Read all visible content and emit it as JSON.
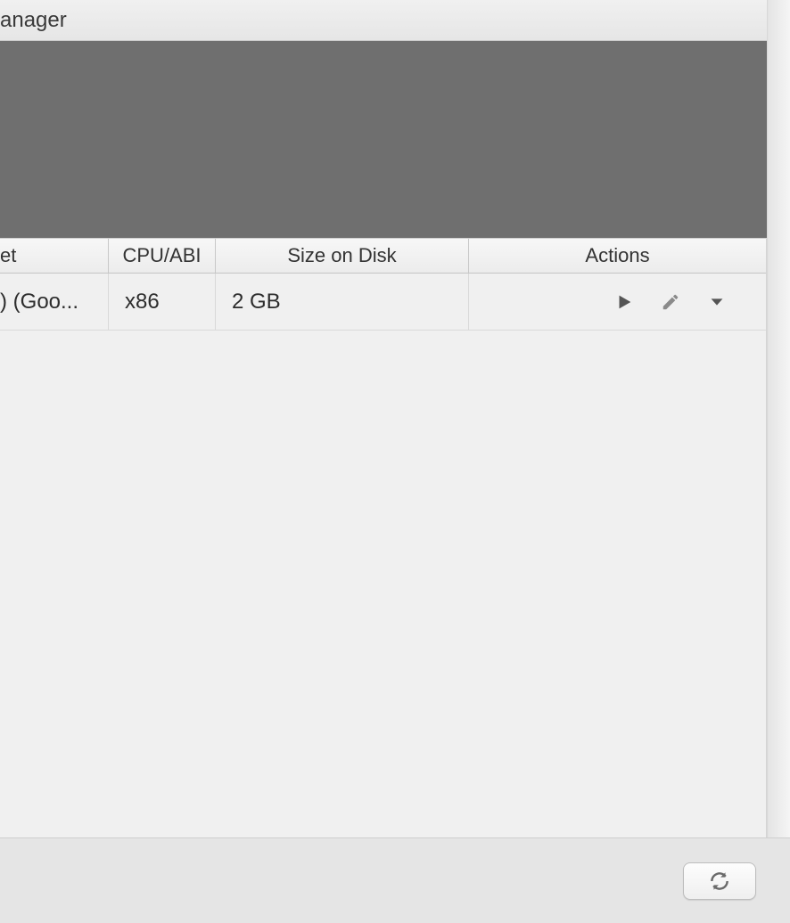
{
  "window": {
    "title_fragment": "anager"
  },
  "table": {
    "headers": {
      "target_fragment": "et",
      "cpu": "CPU/ABI",
      "size": "Size on Disk",
      "actions": "Actions"
    },
    "rows": [
      {
        "target_fragment": ") (Goo...",
        "cpu": "x86",
        "size": "2 GB"
      }
    ]
  },
  "icons": {
    "play": "play-icon",
    "edit": "pencil-icon",
    "menu": "chevron-down-icon",
    "refresh": "refresh-icon"
  }
}
